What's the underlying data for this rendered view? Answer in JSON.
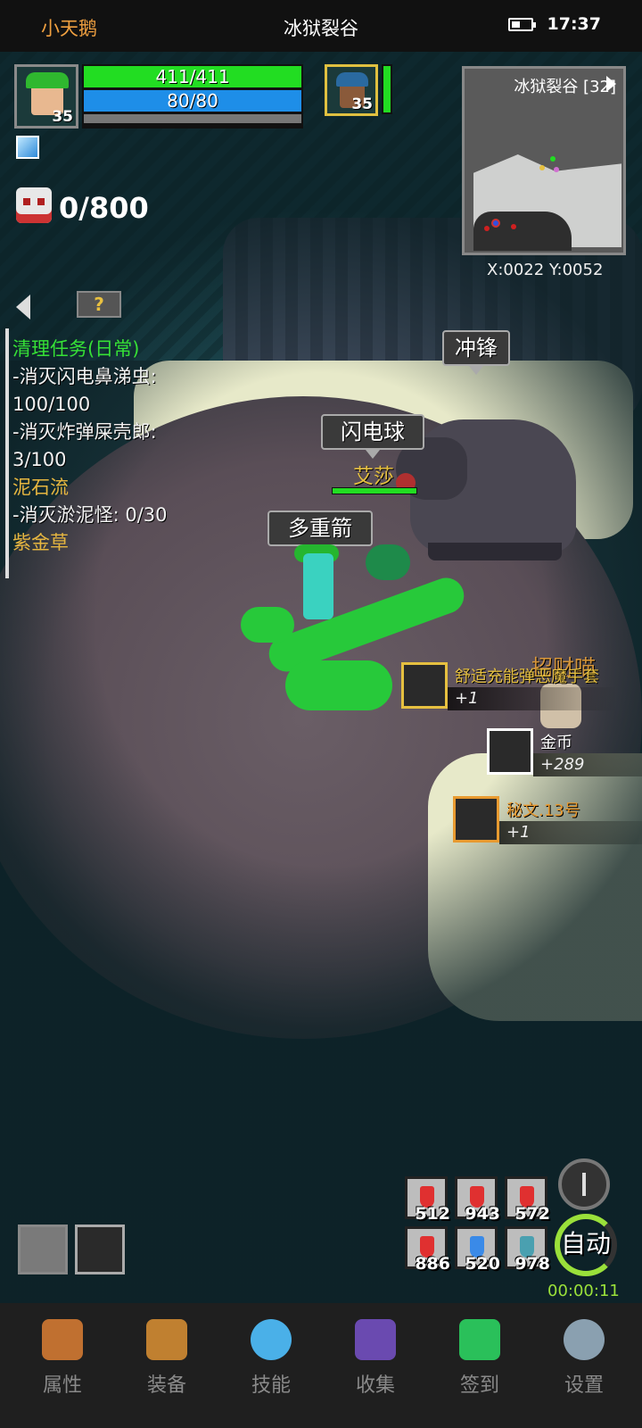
{
  "status_bar": {
    "player_name": "小天鹅",
    "map_name": "冰狱裂谷",
    "time": "17:37"
  },
  "player": {
    "level": "35",
    "hp": "411/411",
    "mp": "80/80"
  },
  "pet": {
    "level": "35"
  },
  "kill_counter": {
    "text": "0/800"
  },
  "minimap": {
    "title": "冰狱裂谷 [32]",
    "coords": "X:0022  Y:0052"
  },
  "quests": {
    "help_icon": "?",
    "lines": [
      {
        "text": "清理任务(日常)",
        "style": "green"
      },
      {
        "text": "-消灭闪电鼻涕虫:",
        "style": "line"
      },
      {
        "text": "100/100",
        "style": "line"
      },
      {
        "text": "-消灭炸弹屎壳郎:",
        "style": "line"
      },
      {
        "text": "3/100",
        "style": "line"
      },
      {
        "text": "泥石流",
        "style": "gold"
      },
      {
        "text": "-消灭淤泥怪: 0/30",
        "style": "line"
      },
      {
        "text": "紫金草",
        "style": "gold"
      }
    ]
  },
  "scene": {
    "skill_bubbles": {
      "charge": "冲锋",
      "lightning": "闪电球",
      "multishot": "多重箭"
    },
    "ally_name": "艾莎",
    "watermark": "招财喵"
  },
  "loot": [
    {
      "name": "舒适充能弹恶魔手套",
      "qty": "+1",
      "color": "#e6c040",
      "icon": "glove-icon"
    },
    {
      "name": "金币",
      "qty": "+289",
      "color": "#ffffff",
      "icon": "gold-coins-icon"
    },
    {
      "name": "秘文.13号",
      "qty": "+1",
      "color": "#e89a30",
      "icon": "rune-scroll-icon"
    }
  ],
  "potions": [
    {
      "count": "512",
      "color": "#e03030"
    },
    {
      "count": "943",
      "color": "#e03030"
    },
    {
      "count": "572",
      "color": "#e03030"
    },
    {
      "count": "886",
      "color": "#e03030"
    },
    {
      "count": "520",
      "color": "#3a8ae8"
    },
    {
      "count": "978",
      "color": "#4aa0b0"
    }
  ],
  "auto": {
    "label": "自动",
    "timer": "00:00:11"
  },
  "nav": [
    {
      "label": "属性",
      "icon": "helmet-icon"
    },
    {
      "label": "装备",
      "icon": "bag-icon"
    },
    {
      "label": "技能",
      "icon": "skill-orb-icon"
    },
    {
      "label": "收集",
      "icon": "book-icon"
    },
    {
      "label": "签到",
      "icon": "gem-icon"
    },
    {
      "label": "设置",
      "icon": "gear-icon"
    }
  ]
}
